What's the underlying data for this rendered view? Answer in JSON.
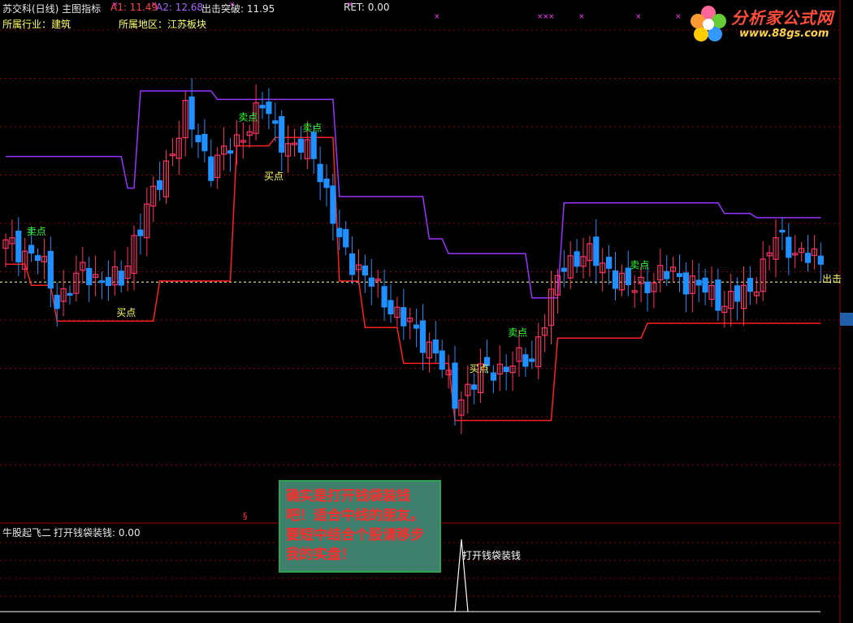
{
  "header": {
    "title": "苏交科(日线) 主图指标",
    "a1": "A1: 11.49",
    "a2": "A2: 12.68",
    "breakout": "出击突破: 11.95",
    "ret": "RET: 0.00",
    "industry": "所属行业：建筑",
    "region": "所属地区：江苏板块"
  },
  "sub_panel": {
    "title": "牛股起飞二",
    "value": "打开钱袋装钱: 0.00",
    "peak_label": "打开钱袋装钱",
    "marker": "§"
  },
  "note_text": "确实是打开钱袋装钱吧！适合中线的朋友。要短中结合个股请移步我的实盘！",
  "logo": {
    "text": "分析家公式网",
    "url": "www.88gs.com"
  },
  "colors": {
    "up": "#ff3366",
    "down": "#1e90ff",
    "resistance": "#9933ff",
    "support": "#ff2020",
    "grid": "#8b0000",
    "dashed": "#ffff99",
    "star": "#ff33ff"
  },
  "chart_data": {
    "type": "candlestick",
    "y_reference": 11.95,
    "labels": [
      {
        "text": "卖点",
        "index": 3,
        "price": 14.2,
        "color": "#33ff33"
      },
      {
        "text": "买点",
        "index": 17,
        "price": 10.35,
        "color": "#ffff66"
      },
      {
        "text": "卖点",
        "index": 36,
        "price": 19.6,
        "color": "#33ff33"
      },
      {
        "text": "买点",
        "index": 40,
        "price": 16.8,
        "color": "#ffff66"
      },
      {
        "text": "卖点",
        "index": 46,
        "price": 19.1,
        "color": "#33ff33"
      },
      {
        "text": "买点",
        "index": 72,
        "price": 7.7,
        "color": "#ffff66"
      },
      {
        "text": "卖点",
        "index": 78,
        "price": 9.4,
        "color": "#33ff33"
      },
      {
        "text": "卖点",
        "index": 97,
        "price": 12.6,
        "color": "#33ff33"
      },
      {
        "text": "出击",
        "index": 118,
        "price": 11.95,
        "color": "#ffff66"
      }
    ]
  }
}
